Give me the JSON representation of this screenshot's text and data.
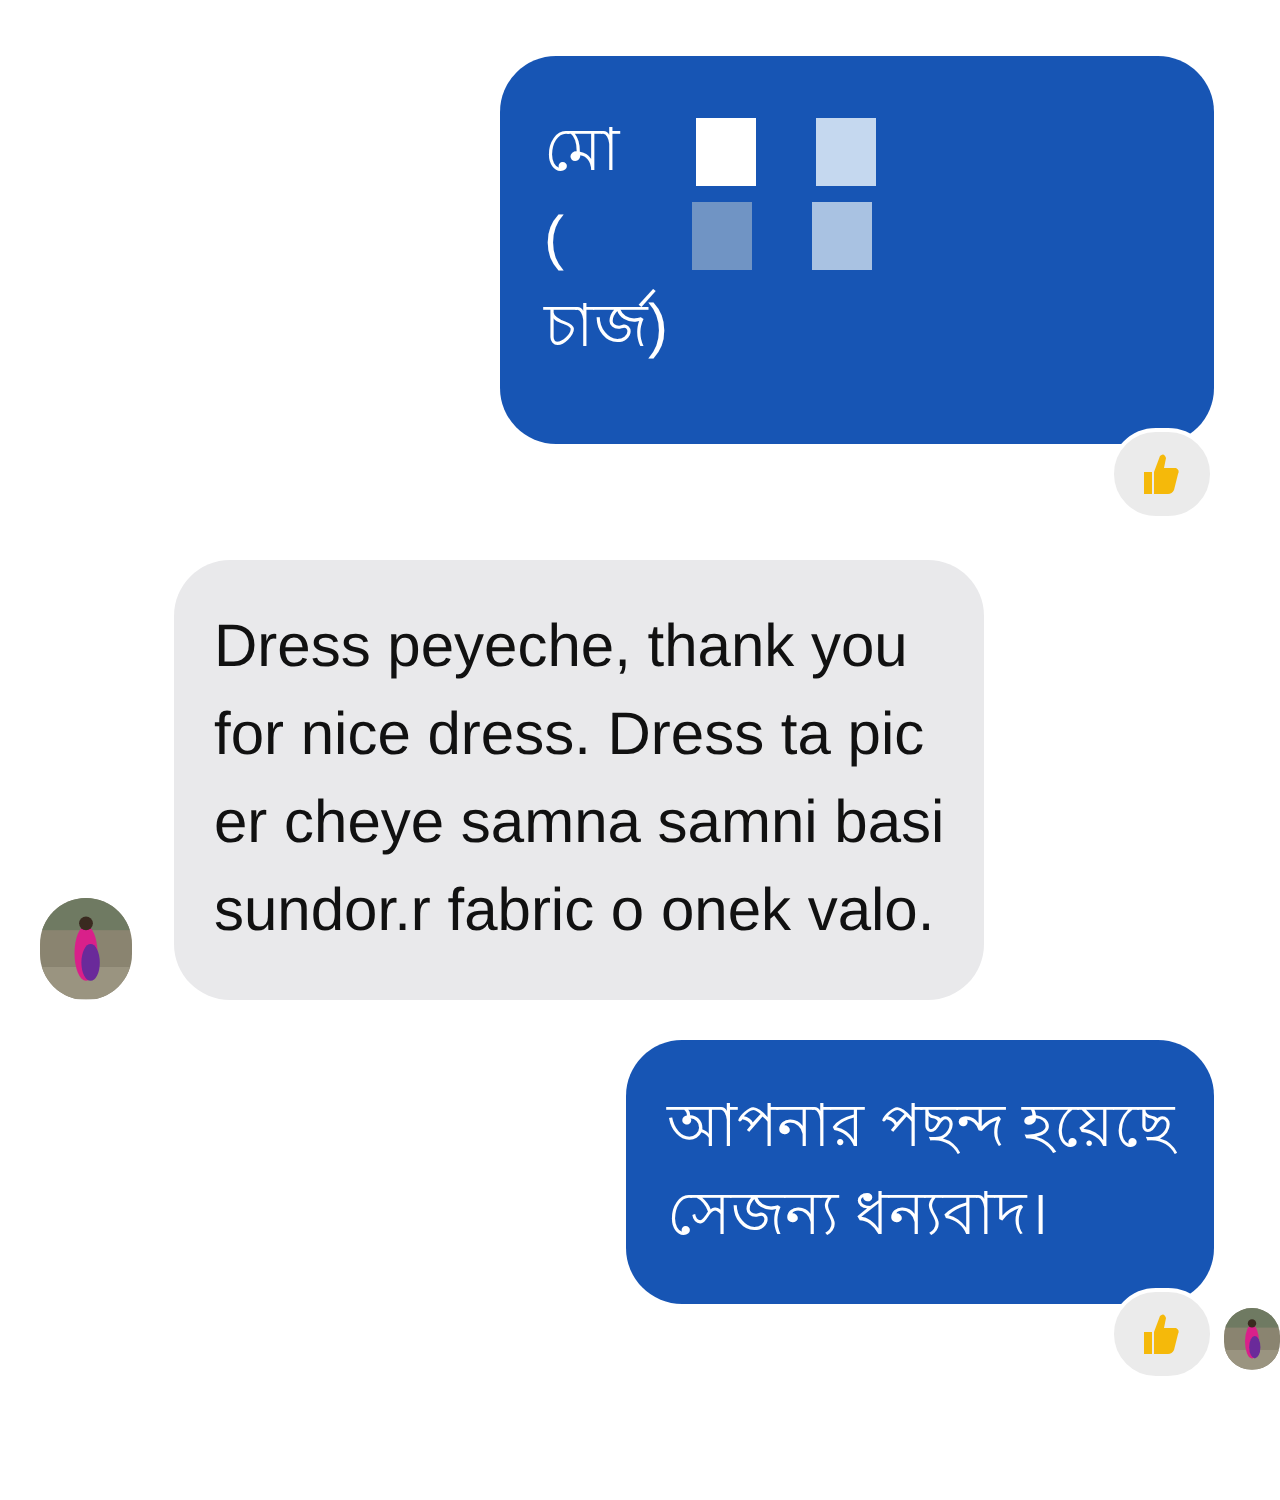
{
  "messages": [
    {
      "kind": "redacted",
      "outgoing": true,
      "lines": [
        "মো",
        "(",
        "চার্জ)"
      ],
      "reaction": true
    },
    {
      "kind": "text",
      "outgoing": false,
      "text": "Dress peyeche, thank you\nfor nice dress. Dress ta pic\ner cheye samna samni basi\nsundor.r fabric o onek valo."
    },
    {
      "kind": "text",
      "outgoing": true,
      "text": "আপনার পছন্দ হয়েছে\nসেজন্য ধন্যবাদ।",
      "reaction": true,
      "seen_avatar": true
    }
  ]
}
